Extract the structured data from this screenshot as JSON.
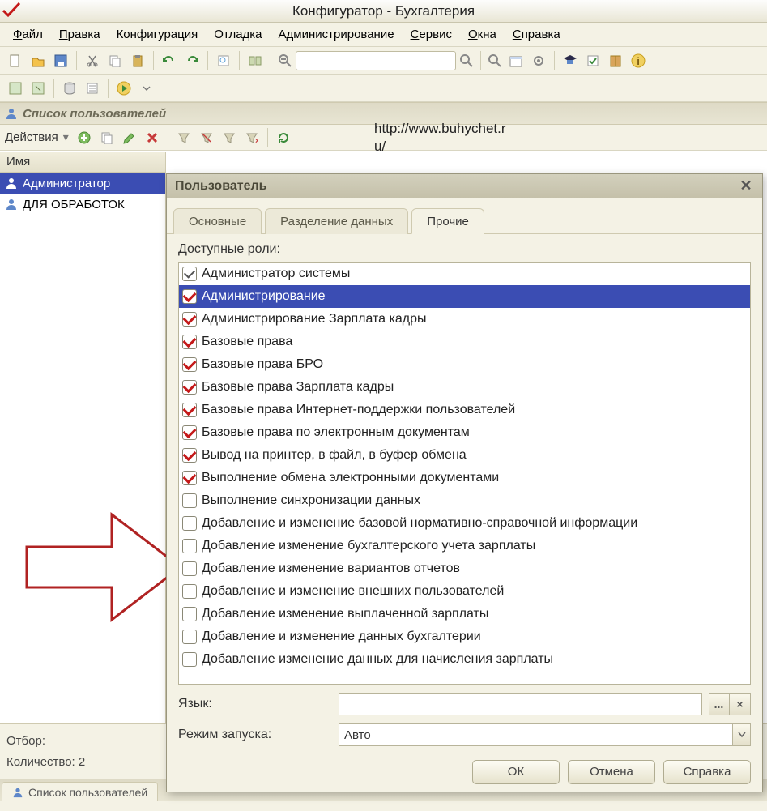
{
  "window": {
    "title": "Конфигуратор - Бухгалтерия"
  },
  "menu": {
    "file": "Файл",
    "edit": "Правка",
    "config": "Конфигурация",
    "debug": "Отладка",
    "admin": "Администрирование",
    "service": "Сервис",
    "windows": "Окна",
    "help": "Справка"
  },
  "overlay": {
    "url_line1": "http://www.buhychet.r",
    "url_line2": "u/"
  },
  "panel": {
    "title": "Список пользователей",
    "actions_label": "Действия",
    "col_name": "Имя"
  },
  "users": {
    "0": {
      "name": "Администратор"
    },
    "1": {
      "name": "ДЛЯ ОБРАБОТОК"
    }
  },
  "footer": {
    "filter": "Отбор:",
    "count": "Количество: 2",
    "tab": "Список пользователей"
  },
  "dialog": {
    "title": "Пользователь",
    "tabs": {
      "main": "Основные",
      "split": "Разделение данных",
      "other": "Прочие"
    },
    "roles_label": "Доступные роли:",
    "lang_label": "Язык:",
    "launch_label": "Режим запуска:",
    "launch_value": "Авто",
    "ok": "ОК",
    "cancel": "Отмена",
    "help": "Справка",
    "ellipsis": "...",
    "clear_x": "×"
  },
  "roles": {
    "0": {
      "label": "Администратор системы"
    },
    "1": {
      "label": "Администрирование"
    },
    "2": {
      "label": "Администрирование Зарплата кадры"
    },
    "3": {
      "label": "Базовые права"
    },
    "4": {
      "label": "Базовые права БРО"
    },
    "5": {
      "label": "Базовые права Зарплата кадры"
    },
    "6": {
      "label": "Базовые права Интернет-поддержки пользователей"
    },
    "7": {
      "label": "Базовые права по электронным документам"
    },
    "8": {
      "label": "Вывод на принтер, в файл, в буфер обмена"
    },
    "9": {
      "label": "Выполнение обмена электронными документами"
    },
    "10": {
      "label": "Выполнение синхронизации данных"
    },
    "11": {
      "label": "Добавление и изменение базовой нормативно-справочной информации"
    },
    "12": {
      "label": "Добавление изменение бухгалтерского учета зарплаты"
    },
    "13": {
      "label": "Добавление изменение вариантов отчетов"
    },
    "14": {
      "label": "Добавление и изменение внешних пользователей"
    },
    "15": {
      "label": "Добавление изменение выплаченной зарплаты"
    },
    "16": {
      "label": "Добавление и изменение данных бухгалтерии"
    },
    "17": {
      "label": "Добавление изменение данных для начисления зарплаты"
    }
  }
}
